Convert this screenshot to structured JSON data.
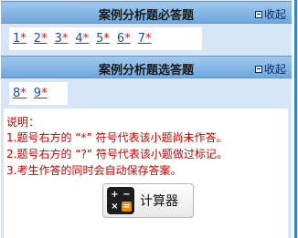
{
  "sections": [
    {
      "title": "案例分析题必答题",
      "collapse_label": "收起",
      "questions": [
        {
          "num": "1",
          "mark": "*"
        },
        {
          "num": "2",
          "mark": "*"
        },
        {
          "num": "3",
          "mark": "*"
        },
        {
          "num": "4",
          "mark": "*"
        },
        {
          "num": "5",
          "mark": "*"
        },
        {
          "num": "6",
          "mark": "*"
        },
        {
          "num": "7",
          "mark": "*"
        }
      ]
    },
    {
      "title": "案例分析题选答题",
      "collapse_label": "收起",
      "questions": [
        {
          "num": "8",
          "mark": "*"
        },
        {
          "num": "9",
          "mark": "*"
        }
      ]
    }
  ],
  "notes": {
    "heading": "说明：",
    "line1": "1.题号右方的 “*” 符号代表该小题尚未作答。",
    "line2": "2.题号右方的 “?” 符号代表该小题做过标记。",
    "line3": "3.考生作答的同时会自动保存答案。"
  },
  "calculator": {
    "label": "计算器",
    "icon": "calculator-icon"
  }
}
